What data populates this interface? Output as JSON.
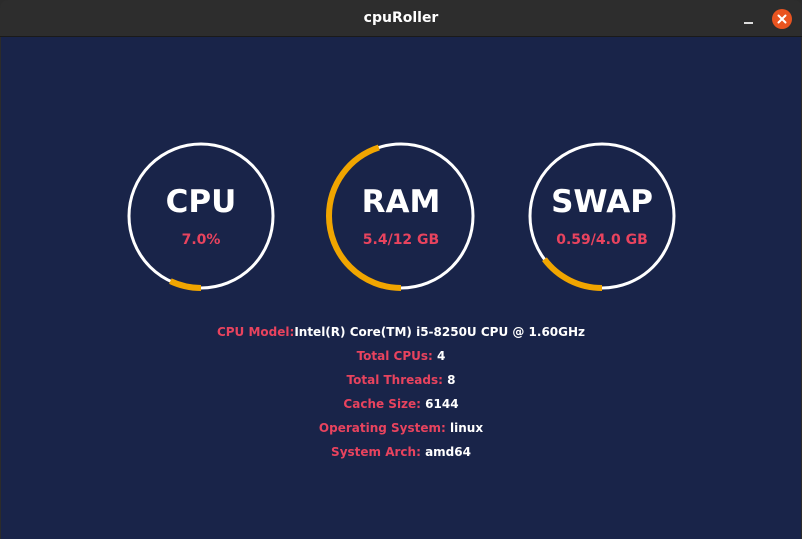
{
  "window": {
    "title": "cpuRoller",
    "minimize_icon": "minimize-icon",
    "close_icon": "close-icon",
    "close_color": "#e95420"
  },
  "colors": {
    "background": "#192449",
    "ring": "#ffffff",
    "arc": "#f0a500",
    "accent": "#e8435e"
  },
  "gauges": [
    {
      "label": "CPU",
      "value": "7.0%",
      "fraction": 0.07
    },
    {
      "label": "RAM",
      "value": "5.4/12 GB",
      "fraction": 0.45
    },
    {
      "label": "SWAP",
      "value": "0.59/4.0 GB",
      "fraction": 0.1475
    }
  ],
  "info": [
    {
      "key": "CPU Model:",
      "value": "Intel(R) Core(TM) i5-8250U CPU @ 1.60GHz"
    },
    {
      "key": "Total CPUs:",
      "value": "4"
    },
    {
      "key": "Total Threads:",
      "value": "8"
    },
    {
      "key": "Cache Size:",
      "value": "6144"
    },
    {
      "key": "Operating System:",
      "value": "linux"
    },
    {
      "key": "System Arch:",
      "value": "amd64"
    }
  ]
}
